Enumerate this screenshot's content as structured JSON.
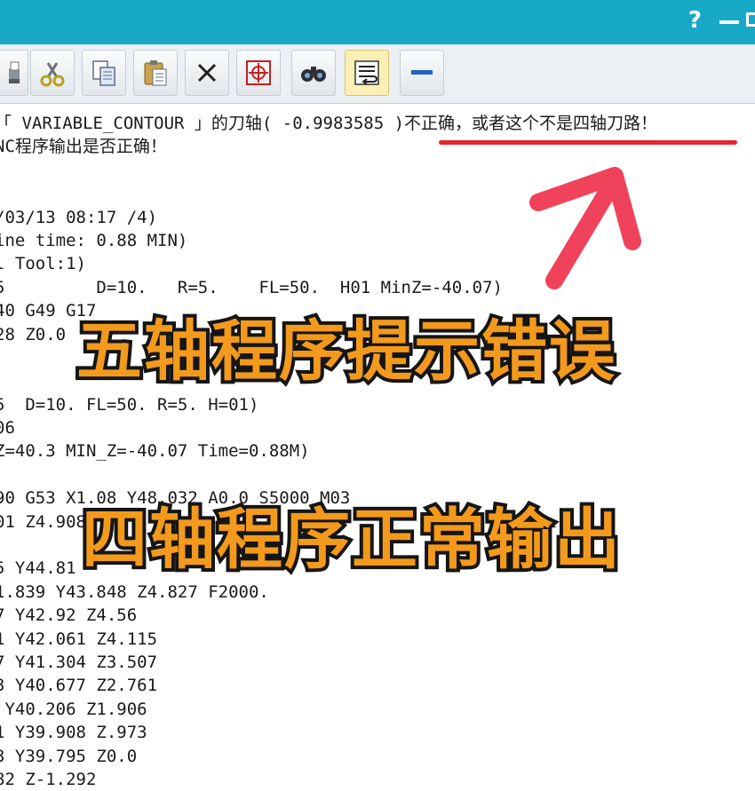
{
  "titlebar": {
    "help": "?",
    "accent": "#17a9c7"
  },
  "toolbar": {
    "buttons": [
      {
        "name": "print-button",
        "icon": "printer-icon"
      },
      {
        "name": "cut-button",
        "icon": "scissors-icon"
      },
      {
        "name": "copy-button",
        "icon": "copy-icon"
      },
      {
        "name": "paste-button",
        "icon": "clipboard-icon"
      },
      {
        "name": "delete-button",
        "icon": "x-icon"
      },
      {
        "name": "locate-button",
        "icon": "crosshair-icon"
      },
      {
        "name": "find-button",
        "icon": "binoculars-icon"
      },
      {
        "name": "wrap-button",
        "icon": "text-wrap-icon"
      },
      {
        "name": "collapse-button",
        "icon": "minus-icon"
      }
    ]
  },
  "output": {
    "lines": [
      "「 VARIABLE_CONTOUR 」的刀轴( -0.9983585 )不正确，或者这个不是四轴刀路！",
      "NC程序输出是否正确！",
      "",
      "",
      "/03/13 08:17 /4)",
      "ine time: 0.88 MIN)",
      "l Tool:1)",
      "5         D=10.   R=5.    FL=50.  H01 MinZ=-40.07)",
      "40 G49 G17",
      "28 Z0.0",
      "",
      "",
      "5  D=10. FL=50. R=5. H=01)",
      "06",
      "Z=40.3 MIN_Z=-40.07 Time=0.88M)",
      "",
      "90 G53 X1.08 Y48.032 A0.0 S5000 M03",
      "01 Z4.908",
      "",
      "5 Y44.81",
      "1.839 Y43.848 Z4.827 F2000.",
      "7 Y42.92 Z4.56",
      "1 Y42.061 Z4.115",
      "7 Y41.304 Z3.507",
      "3 Y40.677 Z2.761",
      " Y40.206 Z1.906",
      "1 Y39.908 Z.973",
      "3 Y39.795 Z0.0",
      "82 Z-1.292"
    ]
  },
  "overlays": {
    "top": "五轴程序提示错误",
    "bottom": "四轴程序正常输出"
  },
  "colors": {
    "annotation": "#e8242c",
    "overlay_fill": "#f39a1c",
    "overlay_stroke": "#151515"
  }
}
